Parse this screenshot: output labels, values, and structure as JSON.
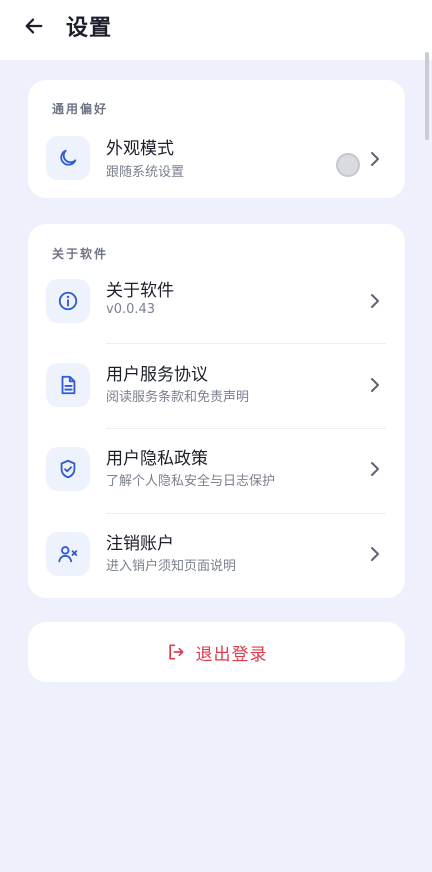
{
  "header": {
    "title": "设置",
    "back_icon": "arrow-left-icon"
  },
  "general": {
    "section_title": "通用偏好",
    "appearance": {
      "title": "外观模式",
      "subtitle": "跟随系统设置",
      "icon": "moon-icon",
      "toggle_on": false
    }
  },
  "about": {
    "section_title": "关于软件",
    "items": [
      {
        "title": "关于软件",
        "subtitle": "v0.0.43",
        "icon": "info-icon"
      },
      {
        "title": "用户服务协议",
        "subtitle": "阅读服务条款和免责声明",
        "icon": "document-icon"
      },
      {
        "title": "用户隐私政策",
        "subtitle": "了解个人隐私安全与日志保护",
        "icon": "shield-check-icon"
      },
      {
        "title": "注销账户",
        "subtitle": "进入销户须知页面说明",
        "icon": "user-remove-icon"
      }
    ]
  },
  "logout": {
    "label": "退出登录",
    "icon": "logout-icon"
  },
  "colors": {
    "accent": "#2f5bd3",
    "danger": "#e03b4d",
    "background": "#eef1fb"
  }
}
